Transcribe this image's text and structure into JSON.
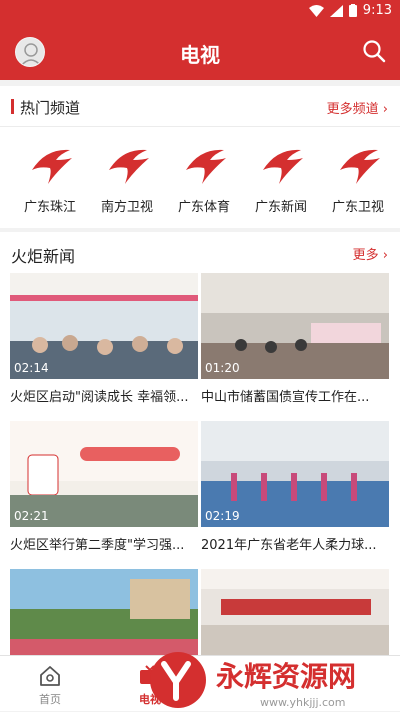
{
  "status": {
    "time": "9:13"
  },
  "appbar": {
    "title": "电视"
  },
  "hot": {
    "title": "热门频道",
    "more": "更多频道 ›",
    "channels": [
      {
        "label": "广东珠江"
      },
      {
        "label": "南方卫视"
      },
      {
        "label": "广东体育"
      },
      {
        "label": "广东新闻"
      },
      {
        "label": "广东卫视"
      }
    ]
  },
  "news": {
    "title": "火炬新闻",
    "more": "更多 ›",
    "items": [
      {
        "duration": "02:14",
        "caption": "火炬区启动\"阅读成长 幸福领..."
      },
      {
        "duration": "01:20",
        "caption": "中山市储蓄国债宣传工作在..."
      },
      {
        "duration": "02:21",
        "caption": "火炬区举行第二季度\"学习强..."
      },
      {
        "duration": "02:19",
        "caption": "2021年广东省老年人柔力球..."
      },
      {
        "duration": "",
        "caption": ""
      },
      {
        "duration": "",
        "caption": ""
      }
    ]
  },
  "tabs": [
    {
      "label": "首页"
    },
    {
      "label": "电视"
    },
    {
      "label": ""
    },
    {
      "label": ""
    }
  ],
  "colors": {
    "brand": "#d42f2f"
  },
  "watermark": {
    "text": "永辉资源网",
    "url": "www.yhkjjj.com"
  }
}
